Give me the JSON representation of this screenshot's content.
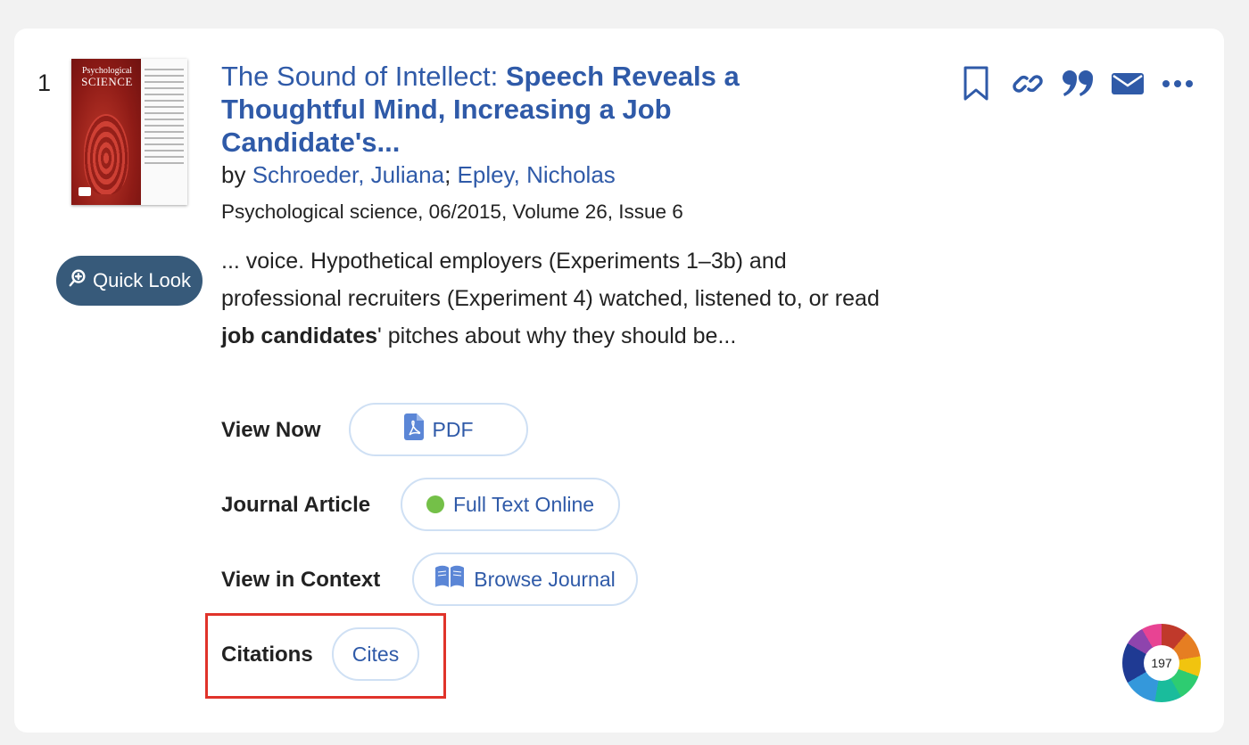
{
  "result": {
    "number": "1",
    "cover": {
      "masthead_line1": "Psychological",
      "masthead_line2": "SCIENCE"
    },
    "quick_look_label": "Quick Look",
    "title_parts": [
      "The Sound of Intellect: ",
      "Speech",
      " Reveals a Thoughtful Mind, Increasing a ",
      "Job",
      " Candidate's..."
    ],
    "authors_prefix": "by ",
    "authors": [
      "Schroeder, Juliana",
      "Epley, Nicholas"
    ],
    "author_separator": "; ",
    "source": "Psychological science, 06/2015, Volume 26, Issue 6",
    "snippet": {
      "before": "... voice. Hypothetical employers (Experiments 1–3b) and professional recruiters (Experiment 4) watched, listened to, or read ",
      "highlight": "job candidates",
      "after": "' pitches about why they should be..."
    },
    "rows": [
      {
        "label": "View Now",
        "button": "PDF",
        "icon": "pdf-file-icon"
      },
      {
        "label": "Journal Article",
        "button": "Full Text Online",
        "icon": "availability-dot-icon",
        "status_color": "#74c048"
      },
      {
        "label": "View in Context",
        "button": "Browse Journal",
        "icon": "open-book-icon"
      },
      {
        "label": "Citations",
        "button": "Cites"
      }
    ],
    "toolbar_icons": [
      "bookmark-icon",
      "link-icon",
      "quote-icon",
      "email-icon",
      "more-icon"
    ],
    "altmetric_score": "197"
  },
  "colors": {
    "link": "#2f5aa8",
    "quick_look_bg": "#375a7a",
    "pill_border": "#cfe0f4",
    "highlight_box": "#e0332a"
  }
}
